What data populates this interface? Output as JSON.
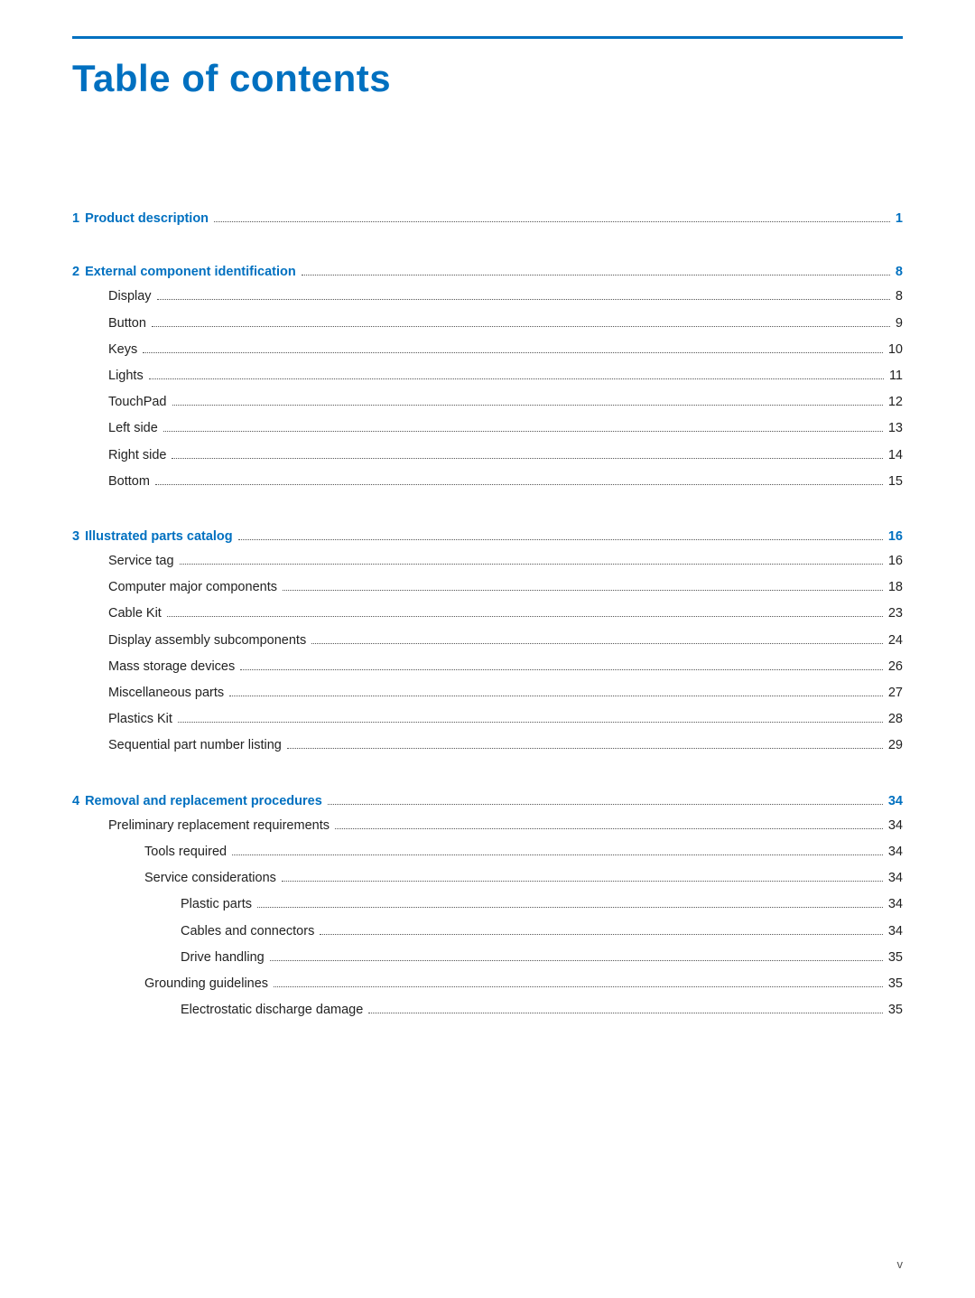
{
  "page": {
    "title": "Table of contents",
    "footer_page": "v"
  },
  "top_rule": true,
  "chapters": [
    {
      "num": "1",
      "label": "Product description",
      "page": "1",
      "page_class": "chapter-page",
      "indent": 0,
      "is_chapter": true,
      "children": []
    },
    {
      "num": "2",
      "label": "External component identification",
      "page": "8",
      "page_class": "chapter-page",
      "indent": 0,
      "is_chapter": true,
      "children": [
        {
          "label": "Display",
          "page": "8",
          "indent": 1
        },
        {
          "label": "Button",
          "page": "9",
          "indent": 1
        },
        {
          "label": "Keys",
          "page": "10",
          "indent": 1
        },
        {
          "label": "Lights",
          "page": "11",
          "indent": 1
        },
        {
          "label": "TouchPad",
          "page": "12",
          "indent": 1
        },
        {
          "label": "Left side",
          "page": "13",
          "indent": 1
        },
        {
          "label": "Right side",
          "page": "14",
          "indent": 1
        },
        {
          "label": "Bottom",
          "page": "15",
          "indent": 1
        }
      ]
    },
    {
      "num": "3",
      "label": "Illustrated parts catalog",
      "page": "16",
      "page_class": "chapter-page",
      "indent": 0,
      "is_chapter": true,
      "children": [
        {
          "label": "Service tag",
          "page": "16",
          "indent": 1
        },
        {
          "label": "Computer major components",
          "page": "18",
          "indent": 1
        },
        {
          "label": "Cable Kit",
          "page": "23",
          "indent": 1
        },
        {
          "label": "Display assembly subcomponents",
          "page": "24",
          "indent": 1
        },
        {
          "label": "Mass storage devices",
          "page": "26",
          "indent": 1
        },
        {
          "label": "Miscellaneous parts",
          "page": "27",
          "indent": 1
        },
        {
          "label": "Plastics Kit",
          "page": "28",
          "indent": 1
        },
        {
          "label": "Sequential part number listing",
          "page": "29",
          "indent": 1
        }
      ]
    },
    {
      "num": "4",
      "label": "Removal and replacement procedures",
      "page": "34",
      "page_class": "chapter-page",
      "indent": 0,
      "is_chapter": true,
      "children": [
        {
          "label": "Preliminary replacement requirements",
          "page": "34",
          "indent": 1
        },
        {
          "label": "Tools required",
          "page": "34",
          "indent": 2
        },
        {
          "label": "Service considerations",
          "page": "34",
          "indent": 2
        },
        {
          "label": "Plastic parts",
          "page": "34",
          "indent": 3
        },
        {
          "label": "Cables and connectors",
          "page": "34",
          "indent": 3
        },
        {
          "label": "Drive handling",
          "page": "35",
          "indent": 3
        },
        {
          "label": "Grounding guidelines",
          "page": "35",
          "indent": 2
        },
        {
          "label": "Electrostatic discharge damage",
          "page": "35",
          "indent": 3
        }
      ]
    }
  ]
}
